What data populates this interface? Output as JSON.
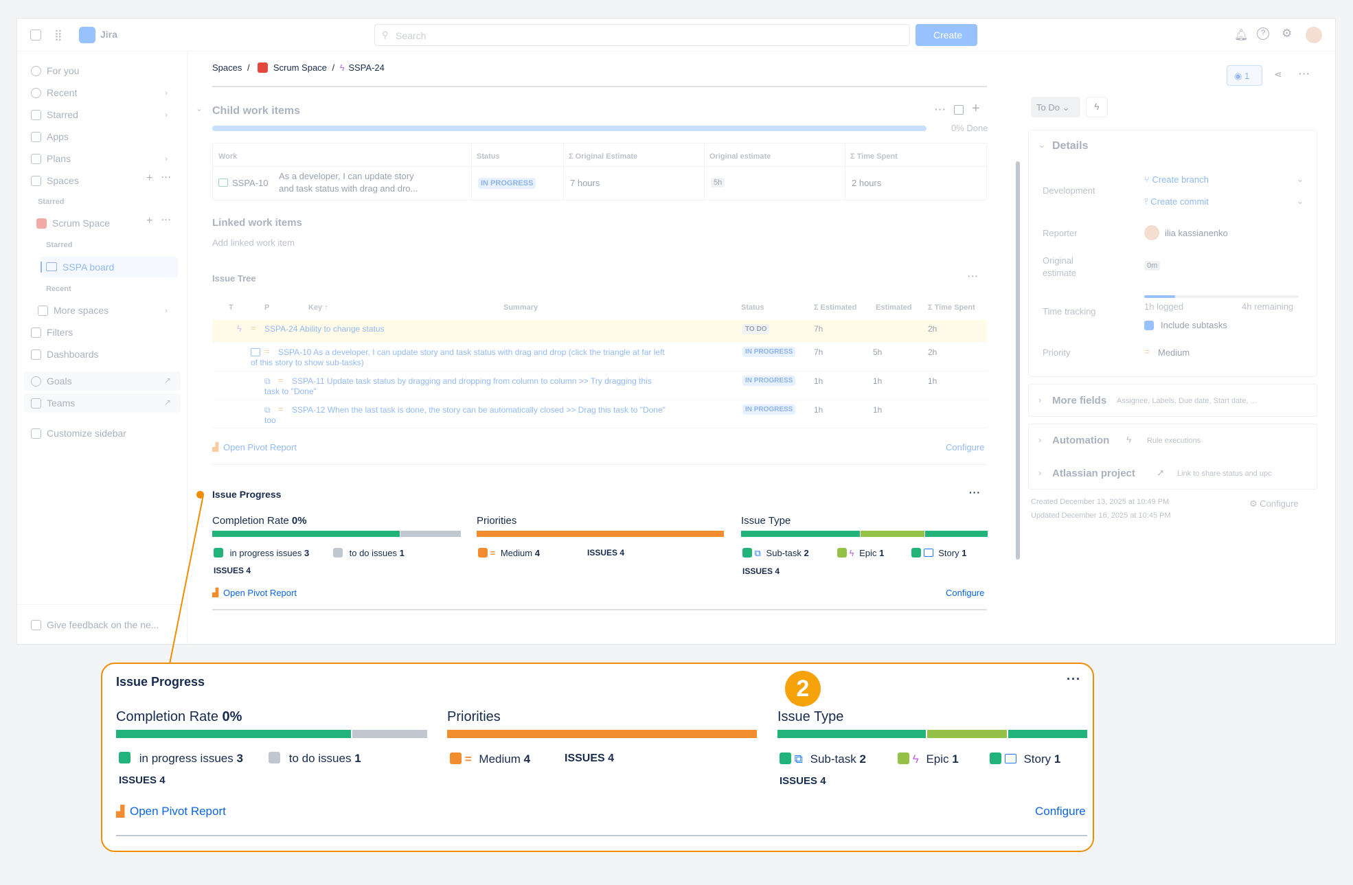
{
  "topbar": {
    "app_name": "Jira",
    "search_placeholder": "Search",
    "create_label": "Create"
  },
  "sidebar": {
    "items": [
      {
        "label": "For you",
        "icon": "user-circle-icon"
      },
      {
        "label": "Recent",
        "icon": "clock-icon"
      },
      {
        "label": "Starred",
        "icon": "star-icon"
      },
      {
        "label": "Apps",
        "icon": "apps-icon"
      },
      {
        "label": "Plans",
        "icon": "plans-icon"
      },
      {
        "label": "Spaces",
        "icon": "spaces-icon"
      }
    ],
    "starred_label": "Starred",
    "space_name": "Scrum Space",
    "space_starred_label": "Starred",
    "board_label": "SSPA board",
    "recent_label": "Recent",
    "more_spaces": "More spaces",
    "filters": "Filters",
    "dashboards": "Dashboards",
    "goals": "Goals",
    "teams": "Teams",
    "customize": "Customize sidebar",
    "feedback": "Give feedback on the ne..."
  },
  "breadcrumb": {
    "spaces": "Spaces",
    "space": "Scrum Space",
    "issue": "SSPA-24",
    "separator": "/"
  },
  "child_items": {
    "title": "Child work items",
    "done_label": "0% Done",
    "headers": [
      "Work",
      "Status",
      "Σ Original Estimate",
      "Original estimate",
      "Σ Time Spent"
    ],
    "row": {
      "key": "SSPA-10",
      "summary_line1": "As a developer, I can update story",
      "summary_line2": "and task status with drag and dro...",
      "status": "IN PROGRESS",
      "sum_estimate": "7 hours",
      "estimate": "5h",
      "time_spent": "2 hours"
    }
  },
  "linked": {
    "title": "Linked work items",
    "add": "Add linked work item"
  },
  "issue_tree": {
    "title": "Issue Tree",
    "headers": [
      "T",
      "P",
      "Key ↑",
      "Summary",
      "Status",
      "Σ Estimated",
      "Estimated",
      "Σ Time Spent"
    ],
    "rows": [
      {
        "text": "SSPA-24 Ability to change status",
        "text2": "",
        "status": "TO DO",
        "sum_est": "7h",
        "est": "",
        "spent": "2h"
      },
      {
        "text": "SSPA-10 As a developer, I can update story and task status with drag and drop (click the triangle at far left",
        "text2": "of this story to show sub-tasks)",
        "status": "IN PROGRESS",
        "sum_est": "7h",
        "est": "5h",
        "spent": "2h"
      },
      {
        "text": "SSPA-11 Update task status by dragging and dropping from column to column >> Try dragging this",
        "text2": "task to \"Done\"",
        "status": "IN PROGRESS",
        "sum_est": "1h",
        "est": "1h",
        "spent": "1h"
      },
      {
        "text": "SSPA-12 When the last task is done, the story can be automatically closed >> Drag this task to \"Done\"",
        "text2": "too",
        "status": "IN PROGRESS",
        "sum_est": "1h",
        "est": "1h",
        "spent": ""
      }
    ],
    "pivot": "Open Pivot Report",
    "configure": "Configure"
  },
  "progress": {
    "title": "Issue Progress",
    "completion_label": "Completion Rate",
    "completion_value": "0%",
    "completion_fraction_in_progress": 0.75,
    "in_progress_label": "in progress issues",
    "in_progress_count": "3",
    "todo_label": "to do issues",
    "todo_count": "1",
    "issues_label": "ISSUES",
    "issues_count": "4",
    "priorities_label": "Priorities",
    "medium_label": "Medium",
    "medium_count": "4",
    "type_label": "Issue Type",
    "subtask_label": "Sub-task",
    "subtask_count": "2",
    "epic_label": "Epic",
    "epic_count": "1",
    "story_label": "Story",
    "story_count": "1",
    "pivot": "Open Pivot Report",
    "configure": "Configure",
    "colors": {
      "green": "#22b37a",
      "grey": "#c1c7d0",
      "orange": "#f18d2f",
      "lime": "#94c147",
      "story_blue": "#1d7afc",
      "epic_purple": "#bf63f3"
    }
  },
  "right_panel": {
    "watch_count": "1",
    "status": "To Do",
    "details": "Details",
    "development": "Development",
    "create_branch": "Create branch",
    "create_commit": "Create commit",
    "reporter": "Reporter",
    "reporter_name": "ilia kassianenko",
    "original_estimate_1": "Original",
    "original_estimate_2": "estimate",
    "orig_value": "0m",
    "time_tracking": "Time tracking",
    "logged": "1h logged",
    "remaining": "4h remaining",
    "include_subtasks": "Include subtasks",
    "priority": "Priority",
    "priority_value": "Medium",
    "more_fields": "More fields",
    "more_fields_hint": "Assignee, Labels, Due date, Start date, ...",
    "automation": "Automation",
    "rule_executions": "Rule executions",
    "atlassian_project": "Atlassian project",
    "link_hint": "Link to share status and upc",
    "created": "Created December 13, 2025 at 10:49 PM",
    "updated": "Updated December 16, 2025 at 10:45 PM",
    "configure": "Configure"
  },
  "callout_number": "2"
}
